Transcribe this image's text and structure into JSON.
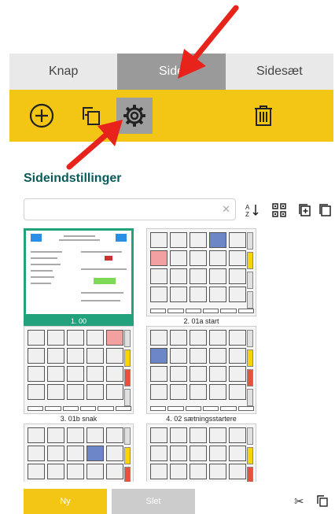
{
  "tabs": [
    {
      "label": "Knap"
    },
    {
      "label": "Side"
    },
    {
      "label": "Sidesæt"
    }
  ],
  "toolbar": {
    "add_icon": "plus-circle-icon",
    "duplicate_icon": "copy-icon",
    "settings_icon": "gear-icon",
    "delete_icon": "trash-icon",
    "color": "#f3c514"
  },
  "panel": {
    "title": "Sideindstillinger",
    "search": {
      "value": "",
      "placeholder": ""
    },
    "tools": [
      "sort-az-icon",
      "grid-icon",
      "add-page-icon",
      "copy-page-icon"
    ]
  },
  "pages": [
    {
      "caption": "1. 00",
      "selected": true
    },
    {
      "caption": "2. 01a start",
      "selected": false
    },
    {
      "caption": "3. 01b snak",
      "selected": false
    },
    {
      "caption": "4. 02 sætningsstartere",
      "selected": false
    },
    {
      "caption": "",
      "selected": false
    },
    {
      "caption": "",
      "selected": false
    }
  ],
  "footer": {
    "new_label": "Ny",
    "delete_label": "Slet",
    "new_color": "#f3c514",
    "delete_color": "#cccccc"
  },
  "colors": {
    "accent": "#21a17c",
    "title": "#0a5a5a",
    "arrow": "#e8231c"
  }
}
